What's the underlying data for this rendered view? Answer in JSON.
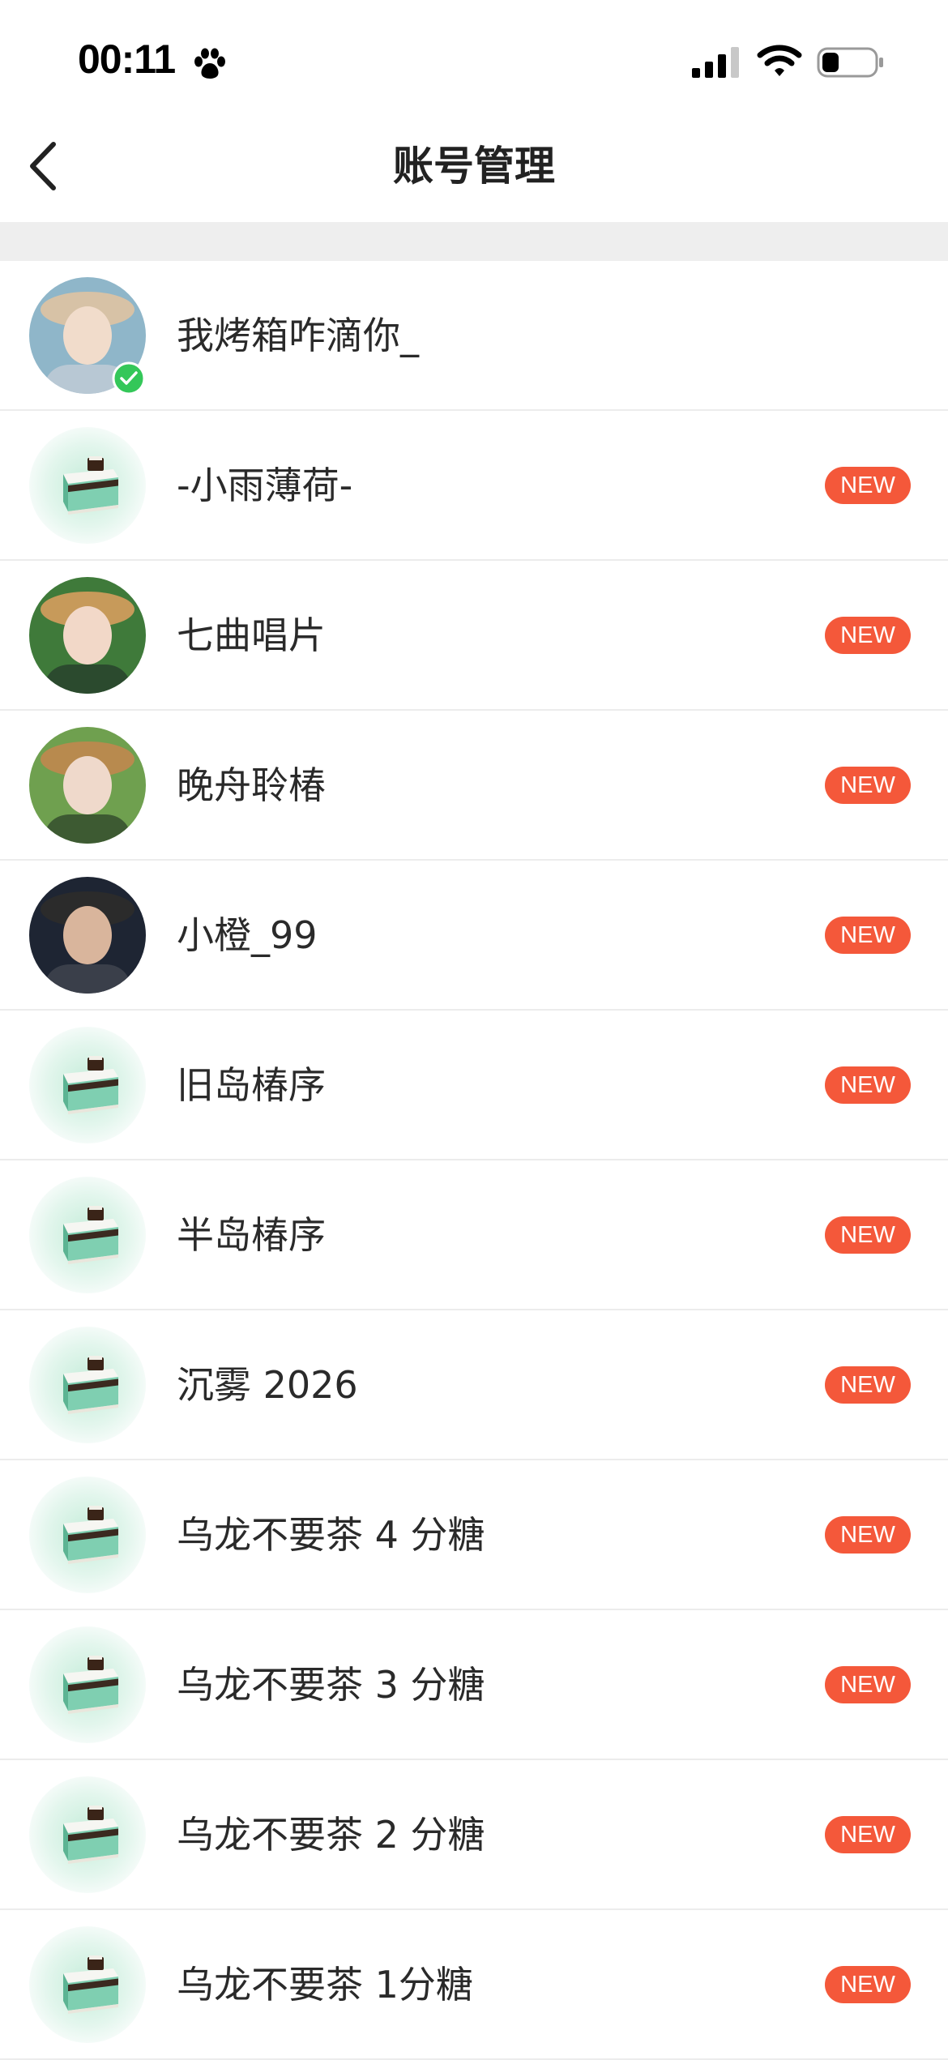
{
  "status_bar": {
    "time": "00:11",
    "icons": [
      "paw-icon",
      "signal-icon",
      "wifi-icon",
      "battery-icon"
    ]
  },
  "nav": {
    "title": "账号管理",
    "back_icon": "chevron-left-icon"
  },
  "accounts": [
    {
      "name": "我烤箱咋滴你_",
      "avatar": "photo-boy-snow",
      "current": true,
      "badge": ""
    },
    {
      "name": "-小雨薄荷-",
      "avatar": "default-cake",
      "current": false,
      "badge": "NEW"
    },
    {
      "name": "七曲唱片",
      "avatar": "photo-girl-hat",
      "current": false,
      "badge": "NEW"
    },
    {
      "name": "晚舟聆椿",
      "avatar": "photo-girl-hat-2",
      "current": false,
      "badge": "NEW"
    },
    {
      "name": "小橙_99",
      "avatar": "photo-boy-eating",
      "current": false,
      "badge": "NEW"
    },
    {
      "name": "旧岛椿序",
      "avatar": "default-cake",
      "current": false,
      "badge": "NEW"
    },
    {
      "name": "半岛椿序",
      "avatar": "default-cake",
      "current": false,
      "badge": "NEW"
    },
    {
      "name": "沉雾 2026",
      "avatar": "default-cake",
      "current": false,
      "badge": "NEW"
    },
    {
      "name": "乌龙不要茶 4 分糖",
      "avatar": "default-cake",
      "current": false,
      "badge": "NEW"
    },
    {
      "name": "乌龙不要茶 3 分糖",
      "avatar": "default-cake",
      "current": false,
      "badge": "NEW"
    },
    {
      "name": "乌龙不要茶 2 分糖",
      "avatar": "default-cake",
      "current": false,
      "badge": "NEW"
    },
    {
      "name": "乌龙不要茶 1分糖",
      "avatar": "default-cake",
      "current": false,
      "badge": "NEW"
    }
  ],
  "colors": {
    "badge": "#f4583a",
    "check": "#34c759",
    "band": "#eeeeee",
    "cake_glow": "#d8f2e6"
  }
}
